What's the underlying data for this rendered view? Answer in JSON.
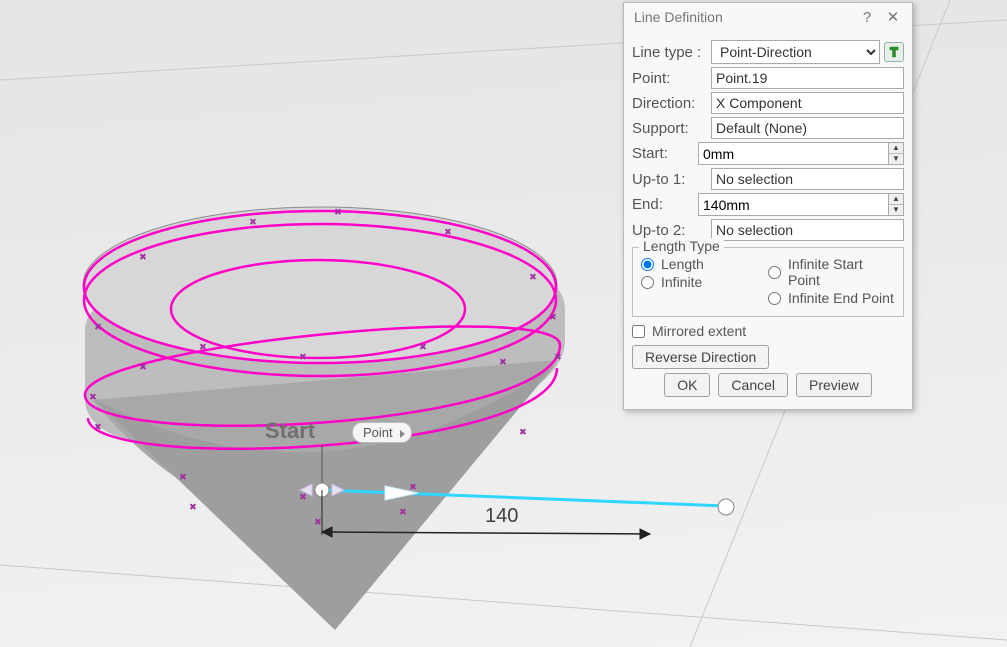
{
  "dialog": {
    "title": "Line Definition",
    "fields": {
      "lineTypeLabel": "Line type :",
      "lineTypeValue": "Point-Direction",
      "pointLabel": "Point:",
      "pointValue": "Point.19",
      "directionLabel": "Direction:",
      "directionValue": "X Component",
      "supportLabel": "Support:",
      "supportValue": "Default (None)",
      "startLabel": "Start:",
      "startValue": "0mm",
      "upto1Label": "Up-to 1:",
      "upto1Value": "No selection",
      "endLabel": "End:",
      "endValue": "140mm",
      "upto2Label": "Up-to 2:",
      "upto2Value": "No selection"
    },
    "lengthType": {
      "legend": "Length Type",
      "length": "Length",
      "infinite": "Infinite",
      "infiniteStart": "Infinite Start Point",
      "infiniteEnd": "Infinite End Point",
      "selected": "length"
    },
    "mirroredExtent": "Mirrored extent",
    "mirroredChecked": false,
    "reverseDirection": "Reverse Direction",
    "buttons": {
      "ok": "OK",
      "cancel": "Cancel",
      "preview": "Preview"
    }
  },
  "viewport": {
    "startLabel": "Start",
    "pointTag": "Point",
    "dimension": "140"
  },
  "colors": {
    "sketch": "#ff00c8",
    "line": "#2fd6ff",
    "accent": "#2a8b2a"
  }
}
